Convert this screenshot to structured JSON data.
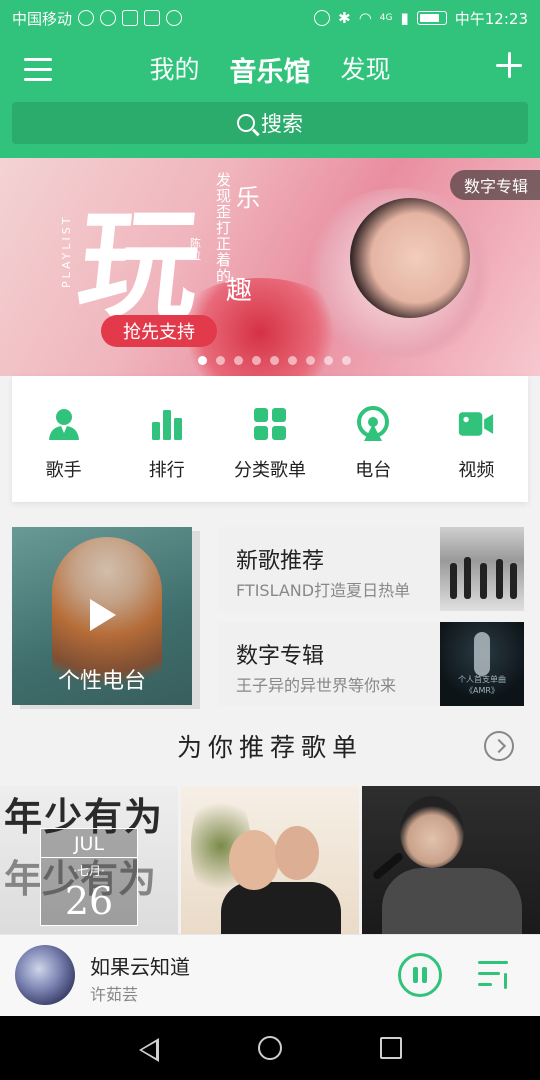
{
  "status_bar": {
    "carrier": "中国移动",
    "network": "4G",
    "time": "中午12:23"
  },
  "header": {
    "tabs": [
      {
        "label": "我的",
        "active": false
      },
      {
        "label": "音乐馆",
        "active": true
      },
      {
        "label": "发现",
        "active": false
      }
    ],
    "search_label": "搜索",
    "accent_color": "#31c27c"
  },
  "banner": {
    "big_char": "玩",
    "playlist_word": "PLAYLIST",
    "vertical_text": "发现歪打正着的",
    "char_le": "乐",
    "char_qu": "趣",
    "artist": "陈粒",
    "cta": "抢先支持",
    "badge": "数字专辑",
    "dot_count": 9,
    "active_dot": 0
  },
  "quick_nav": [
    {
      "label": "歌手",
      "icon": "singer-icon"
    },
    {
      "label": "排行",
      "icon": "ranking-bars-icon"
    },
    {
      "label": "分类歌单",
      "icon": "category-grid-icon"
    },
    {
      "label": "电台",
      "icon": "radio-icon"
    },
    {
      "label": "视频",
      "icon": "video-camera-icon"
    }
  ],
  "personal_radio": {
    "label": "个性电台"
  },
  "promos": [
    {
      "title": "新歌推荐",
      "subtitle": "FTISLAND打造夏日热单"
    },
    {
      "title": "数字专辑",
      "subtitle": "王子异的异世界等你来",
      "cover_text": "个人首支单曲《AMR》"
    }
  ],
  "recommend": {
    "title": "为你推荐歌单",
    "playlists": [
      {
        "bg_text_1": "年少有为",
        "bg_text_2": "年少有为",
        "month": "JUL",
        "cn_month": "·七月·",
        "day": "26"
      },
      {},
      {}
    ]
  },
  "player": {
    "song": "如果云知道",
    "artist": "许茹芸"
  }
}
